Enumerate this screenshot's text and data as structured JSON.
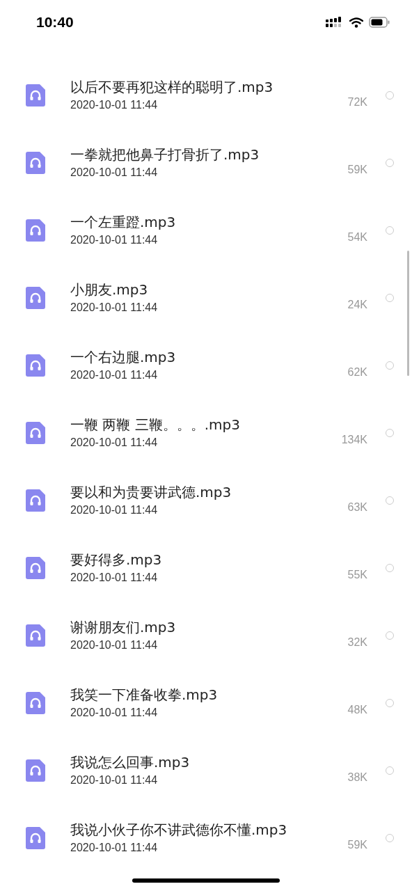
{
  "status_bar": {
    "time": "10:40"
  },
  "files": [
    {
      "name": "以后不要再犯这样的聪明了.mp3",
      "date": "2020-10-01 11:44",
      "size": "72K",
      "selected": false
    },
    {
      "name": "一拳就把他鼻子打骨折了.mp3",
      "date": "2020-10-01 11:44",
      "size": "59K",
      "selected": false
    },
    {
      "name": "一个左重蹬.mp3",
      "date": "2020-10-01 11:44",
      "size": "54K",
      "selected": false
    },
    {
      "name": "小朋友.mp3",
      "date": "2020-10-01 11:44",
      "size": "24K",
      "selected": false
    },
    {
      "name": "一个右边腿.mp3",
      "date": "2020-10-01 11:44",
      "size": "62K",
      "selected": false
    },
    {
      "name": "一鞭 两鞭 三鞭。。。.mp3",
      "date": "2020-10-01 11:44",
      "size": "134K",
      "selected": false
    },
    {
      "name": "要以和为贵要讲武德.mp3",
      "date": "2020-10-01 11:44",
      "size": "63K",
      "selected": false
    },
    {
      "name": "要好得多.mp3",
      "date": "2020-10-01 11:44",
      "size": "55K",
      "selected": false
    },
    {
      "name": "谢谢朋友们.mp3",
      "date": "2020-10-01 11:44",
      "size": "32K",
      "selected": false
    },
    {
      "name": "我笑一下准备收拳.mp3",
      "date": "2020-10-01 11:44",
      "size": "48K",
      "selected": false
    },
    {
      "name": "我说怎么回事.mp3",
      "date": "2020-10-01 11:44",
      "size": "38K",
      "selected": false
    },
    {
      "name": "我说小伙子你不讲武德你不懂.mp3",
      "date": "2020-10-01 11:44",
      "size": "59K",
      "selected": false
    }
  ]
}
